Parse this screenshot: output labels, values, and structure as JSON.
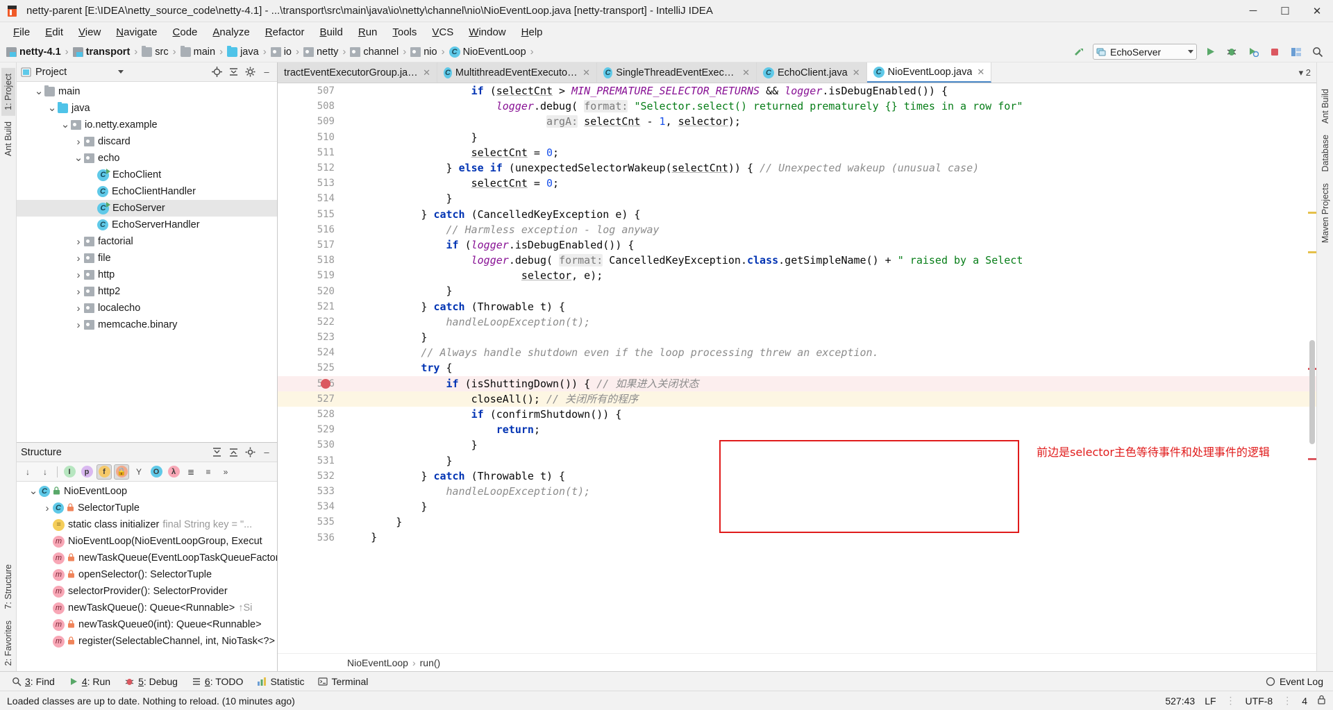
{
  "titlebar": {
    "title": "netty-parent [E:\\IDEA\\netty_source_code\\netty-4.1] - ...\\transport\\src\\main\\java\\io\\netty\\channel\\nio\\NioEventLoop.java [netty-transport] - IntelliJ IDEA",
    "minimize": "─",
    "maximize": "☐",
    "close": "✕"
  },
  "menubar": {
    "items": [
      "File",
      "Edit",
      "View",
      "Navigate",
      "Code",
      "Analyze",
      "Refactor",
      "Build",
      "Run",
      "Tools",
      "VCS",
      "Window",
      "Help"
    ]
  },
  "navbar": {
    "crumbs": [
      {
        "label": "netty-4.1",
        "icon": "module-icon",
        "bold": true
      },
      {
        "label": "transport",
        "icon": "module-icon",
        "bold": true
      },
      {
        "label": "src",
        "icon": "folder-icon",
        "bold": false
      },
      {
        "label": "main",
        "icon": "folder-icon",
        "bold": false
      },
      {
        "label": "java",
        "icon": "source-folder-icon",
        "bold": false
      },
      {
        "label": "io",
        "icon": "package-icon",
        "bold": false
      },
      {
        "label": "netty",
        "icon": "package-icon",
        "bold": false
      },
      {
        "label": "channel",
        "icon": "package-icon",
        "bold": false
      },
      {
        "label": "nio",
        "icon": "package-icon",
        "bold": false
      },
      {
        "label": "NioEventLoop",
        "icon": "class-icon",
        "bold": false
      }
    ],
    "run_config": "EchoServer",
    "buttons": [
      "build-icon",
      "run-icon",
      "debug-icon",
      "coverage-icon",
      "profile-icon",
      "stop-icon",
      "layout-icon",
      "search-icon"
    ]
  },
  "left_rail": {
    "tabs": [
      "1: Project",
      "Ant Build"
    ]
  },
  "right_rail": {
    "tabs": [
      "Ant Build",
      "Database",
      "Maven Projects"
    ]
  },
  "bottom_left_rail": {
    "tabs": [
      "7: Structure",
      "2: Favorites"
    ]
  },
  "project_panel": {
    "title": "Project",
    "icons": [
      "locate-icon",
      "collapse-all-icon",
      "settings-icon",
      "hide-icon"
    ],
    "tree": [
      {
        "label": "main",
        "indent": 4,
        "arrow": "down",
        "icon": "folder-icon",
        "selected": false
      },
      {
        "label": "java",
        "indent": 5,
        "arrow": "down",
        "icon": "source-folder-icon",
        "selected": false
      },
      {
        "label": "io.netty.example",
        "indent": 6,
        "arrow": "down",
        "icon": "package-icon",
        "selected": false
      },
      {
        "label": "discard",
        "indent": 7,
        "arrow": "right",
        "icon": "package-icon",
        "selected": false
      },
      {
        "label": "echo",
        "indent": 7,
        "arrow": "down",
        "icon": "package-icon",
        "selected": false
      },
      {
        "label": "EchoClient",
        "indent": 8,
        "arrow": "none",
        "icon": "class-runnable-icon",
        "selected": false
      },
      {
        "label": "EchoClientHandler",
        "indent": 8,
        "arrow": "none",
        "icon": "class-icon",
        "selected": false
      },
      {
        "label": "EchoServer",
        "indent": 8,
        "arrow": "none",
        "icon": "class-runnable-icon",
        "selected": true
      },
      {
        "label": "EchoServerHandler",
        "indent": 8,
        "arrow": "none",
        "icon": "class-icon",
        "selected": false
      },
      {
        "label": "factorial",
        "indent": 7,
        "arrow": "right",
        "icon": "package-icon",
        "selected": false
      },
      {
        "label": "file",
        "indent": 7,
        "arrow": "right",
        "icon": "package-icon",
        "selected": false
      },
      {
        "label": "http",
        "indent": 7,
        "arrow": "right",
        "icon": "package-icon",
        "selected": false
      },
      {
        "label": "http2",
        "indent": 7,
        "arrow": "right",
        "icon": "package-icon",
        "selected": false
      },
      {
        "label": "localecho",
        "indent": 7,
        "arrow": "right",
        "icon": "package-icon",
        "selected": false
      },
      {
        "label": "memcache.binary",
        "indent": 7,
        "arrow": "right",
        "icon": "package-icon",
        "selected": false
      }
    ]
  },
  "structure_panel": {
    "title": "Structure",
    "head_icons": [
      "expand-all-icon",
      "collapse-all-icon",
      "settings-icon",
      "hide-icon"
    ],
    "toolbar": [
      {
        "name": "sort-by-visibility-icon",
        "label": "↓",
        "active": false
      },
      {
        "name": "sort-alphabetically-icon",
        "label": "↓",
        "active": false
      },
      {
        "name": "show-inherited-icon",
        "label": "I",
        "active": false
      },
      {
        "name": "show-properties-icon",
        "label": "p",
        "active": false
      },
      {
        "name": "show-fields-icon",
        "label": "f",
        "active": true
      },
      {
        "name": "show-non-public-icon",
        "label": "🔒",
        "active": true
      },
      {
        "name": "show-anonymous-icon",
        "label": "Y",
        "active": false
      },
      {
        "name": "show-interfaces-icon",
        "label": "O",
        "active": false
      },
      {
        "name": "show-lambdas-icon",
        "label": "λ",
        "active": false
      },
      {
        "name": "expand-all-icon",
        "label": "≣",
        "active": false
      },
      {
        "name": "collapse-all-icon",
        "label": "≡",
        "active": false
      },
      {
        "name": "more-icon",
        "label": "»",
        "active": false
      }
    ],
    "tree": [
      {
        "label": "NioEventLoop",
        "note": "",
        "indent": 1,
        "arrow": "down",
        "icon": "class-icon",
        "lock": "green"
      },
      {
        "label": "SelectorTuple",
        "note": "",
        "indent": 2,
        "arrow": "right",
        "icon": "class-icon",
        "lock": "orange"
      },
      {
        "label": "static class initializer",
        "note": "final String key = \"...",
        "indent": 2,
        "arrow": "none",
        "icon": "initializer-icon",
        "lock": "none"
      },
      {
        "label": "NioEventLoop(NioEventLoopGroup, Execut",
        "note": "",
        "indent": 2,
        "arrow": "none",
        "icon": "method-icon",
        "lock": "none"
      },
      {
        "label": "newTaskQueue(EventLoopTaskQueueFactor",
        "note": "",
        "indent": 2,
        "arrow": "none",
        "icon": "method-icon",
        "lock": "orange"
      },
      {
        "label": "openSelector(): SelectorTuple",
        "note": "",
        "indent": 2,
        "arrow": "none",
        "icon": "method-icon",
        "lock": "orange"
      },
      {
        "label": "selectorProvider(): SelectorProvider",
        "note": "",
        "indent": 2,
        "arrow": "none",
        "icon": "method-icon",
        "lock": "none"
      },
      {
        "label": "newTaskQueue(): Queue<Runnable>",
        "note": "↑Si",
        "indent": 2,
        "arrow": "none",
        "icon": "method-icon",
        "lock": "none"
      },
      {
        "label": "newTaskQueue0(int): Queue<Runnable>",
        "note": "",
        "indent": 2,
        "arrow": "none",
        "icon": "method-icon",
        "lock": "orange"
      },
      {
        "label": "register(SelectableChannel, int, NioTask<?>",
        "note": "",
        "indent": 2,
        "arrow": "none",
        "icon": "method-icon",
        "lock": "orange"
      }
    ]
  },
  "editor": {
    "tabs": [
      {
        "label": "tractEventExecutorGroup.java",
        "icon": "none",
        "active": false,
        "close": true
      },
      {
        "label": "MultithreadEventExecutorGroup.java",
        "icon": "class-icon",
        "active": false,
        "close": true
      },
      {
        "label": "SingleThreadEventExecutor.java",
        "icon": "class-icon",
        "active": false,
        "close": true
      },
      {
        "label": "EchoClient.java",
        "icon": "class-icon",
        "active": false,
        "close": true
      },
      {
        "label": "NioEventLoop.java",
        "icon": "class-icon",
        "active": true,
        "close": true
      }
    ],
    "tabs_overflow": "▾ 2",
    "breadcrumb": [
      "NioEventLoop",
      "run()"
    ],
    "first_line": 507,
    "lines": [
      {
        "n": 507,
        "hl": "none",
        "html": "                    <span class=\"kw\">if</span> (<span class=\"und\">selectCnt</span> &gt; <span class=\"fld\">MIN_PREMATURE_SELECTOR_RETURNS</span> &amp;&amp; <span class=\"fld\">logger</span>.isDebugEnabled()) {"
      },
      {
        "n": 508,
        "hl": "none",
        "html": "                        <span class=\"fld\">logger</span>.debug( <span class=\"hint\">format:</span> <span class=\"st\">\"Selector.select() returned prematurely {} times in a row for\"</span>"
      },
      {
        "n": 509,
        "hl": "none",
        "html": "                                <span class=\"hint\">argA:</span> <span class=\"und\">selectCnt</span> - <span class=\"num\">1</span>, <span class=\"und\">selector</span>);"
      },
      {
        "n": 510,
        "hl": "none",
        "html": "                    }"
      },
      {
        "n": 511,
        "hl": "none",
        "html": "                    <span class=\"und\">selectCnt</span> = <span class=\"num\">0</span>;"
      },
      {
        "n": 512,
        "hl": "none",
        "html": "                } <span class=\"kw\">else if</span> (unexpectedSelectorWakeup(<span class=\"und\">selectCnt</span>)) { <span class=\"cm\">// Unexpected wakeup (unusual case)</span>"
      },
      {
        "n": 513,
        "hl": "none",
        "html": "                    <span class=\"und\">selectCnt</span> = <span class=\"num\">0</span>;"
      },
      {
        "n": 514,
        "hl": "none",
        "html": "                }"
      },
      {
        "n": 515,
        "hl": "none",
        "html": "            } <span class=\"kw\">catch</span> (CancelledKeyException e) {"
      },
      {
        "n": 516,
        "hl": "none",
        "html": "                <span class=\"cm\">// Harmless exception - log anyway</span>"
      },
      {
        "n": 517,
        "hl": "none",
        "html": "                <span class=\"kw\">if</span> (<span class=\"fld\">logger</span>.isDebugEnabled()) {"
      },
      {
        "n": 518,
        "hl": "none",
        "html": "                    <span class=\"fld\">logger</span>.debug( <span class=\"hint\">format:</span> CancelledKeyException.<span class=\"kw\">class</span>.getSimpleName() + <span class=\"st\">\" raised by a Select</span>"
      },
      {
        "n": 519,
        "hl": "none",
        "html": "                            <span class=\"und\">selector</span>, e);"
      },
      {
        "n": 520,
        "hl": "none",
        "html": "                }"
      },
      {
        "n": 521,
        "hl": "none",
        "html": "            } <span class=\"kw\">catch</span> (Throwable t) {"
      },
      {
        "n": 522,
        "hl": "none",
        "html": "                <span class=\"cm\">handleLoopException(t);</span>"
      },
      {
        "n": 523,
        "hl": "none",
        "html": "            }"
      },
      {
        "n": 524,
        "hl": "none",
        "html": "            <span class=\"cm\">// Always handle shutdown even if the loop processing threw an exception.</span>"
      },
      {
        "n": 525,
        "hl": "none",
        "html": "            <span class=\"kw\">try</span> {"
      },
      {
        "n": 526,
        "hl": "pink",
        "html": "                <span class=\"kw\">if</span> (isShuttingDown()) { <span class=\"cm\">// 如果进入关闭状态</span>"
      },
      {
        "n": 527,
        "hl": "yellow",
        "html": "                    closeAll(); <span class=\"cm\">// 关闭所有的程序</span>"
      },
      {
        "n": 528,
        "hl": "none",
        "html": "                    <span class=\"kw\">if</span> (confirmShutdown()) {"
      },
      {
        "n": 529,
        "hl": "none",
        "html": "                        <span class=\"kw\">return</span>;"
      },
      {
        "n": 530,
        "hl": "none",
        "html": "                    }"
      },
      {
        "n": 531,
        "hl": "none",
        "html": "                }"
      },
      {
        "n": 532,
        "hl": "none",
        "html": "            } <span class=\"kw\">catch</span> (Throwable t) {"
      },
      {
        "n": 533,
        "hl": "none",
        "html": "                <span class=\"cm\">handleLoopException(t);</span>"
      },
      {
        "n": 534,
        "hl": "none",
        "html": "            }"
      },
      {
        "n": 535,
        "hl": "none",
        "html": "        }"
      },
      {
        "n": 536,
        "hl": "none",
        "html": "    }"
      }
    ],
    "annotation": "前边是selector主色等待事件和处理事件的逻辑",
    "annotation_color": "#e01b1b",
    "redbox_color": "#e01b1b"
  },
  "toolwindow_bar": {
    "items": [
      {
        "label": "Find",
        "prefix": "3:",
        "icon": "search-icon"
      },
      {
        "label": "Run",
        "prefix": "4:",
        "icon": "run-icon"
      },
      {
        "label": "Debug",
        "prefix": "5:",
        "icon": "debug-icon"
      },
      {
        "label": "TODO",
        "prefix": "6:",
        "icon": "todo-icon"
      },
      {
        "label": "Statistic",
        "prefix": "",
        "icon": "statistic-icon"
      },
      {
        "label": "Terminal",
        "prefix": "",
        "icon": "terminal-icon"
      }
    ],
    "right": "Event Log"
  },
  "statusbar": {
    "message": "Loaded classes are up to date. Nothing to reload. (10 minutes ago)",
    "position": "527:43",
    "line_separator": "LF",
    "encoding": "UTF-8",
    "indent": "4",
    "lock_icon": "lock-icon"
  }
}
